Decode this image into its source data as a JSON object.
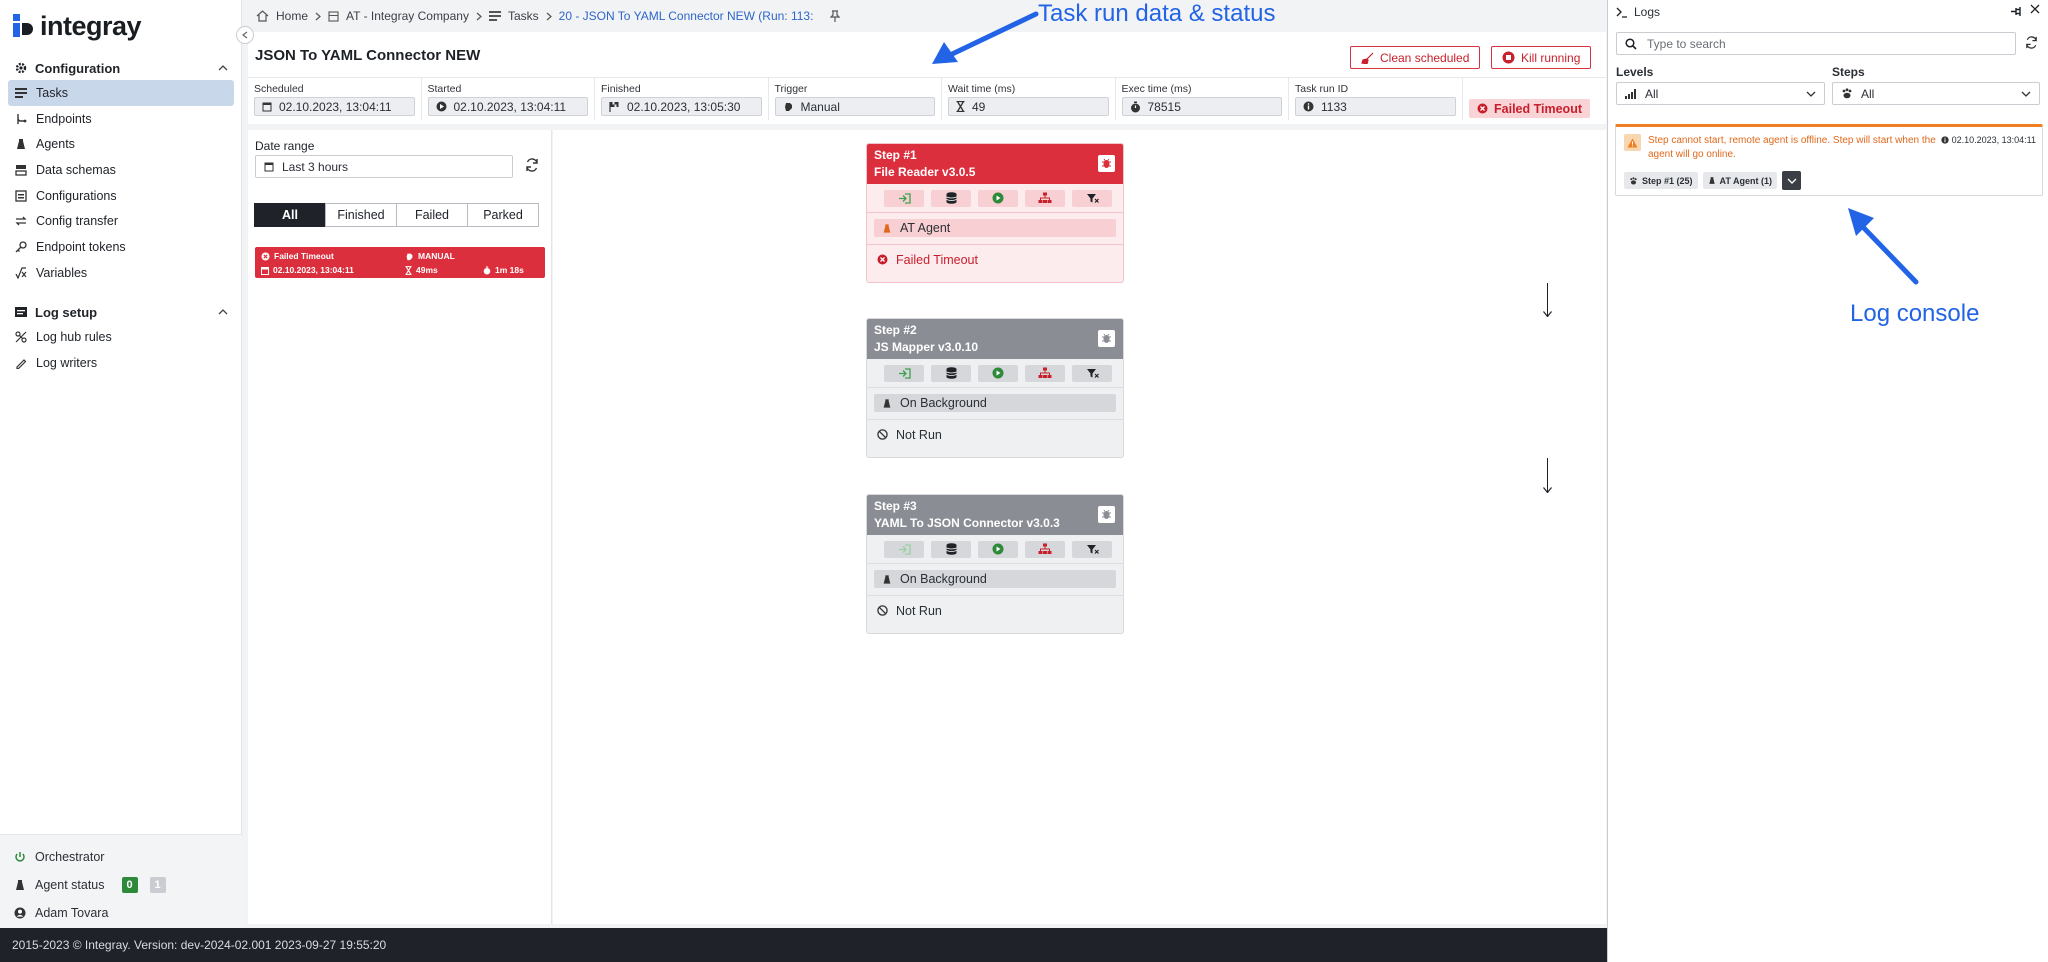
{
  "app": {
    "name": "integray"
  },
  "sidebar": {
    "sections": [
      {
        "title": "Configuration",
        "items": [
          {
            "label": "Tasks",
            "icon": "tasks-icon",
            "active": true
          },
          {
            "label": "Endpoints",
            "icon": "endpoints-icon"
          },
          {
            "label": "Agents",
            "icon": "agents-icon"
          },
          {
            "label": "Data schemas",
            "icon": "data-schemas-icon"
          },
          {
            "label": "Configurations",
            "icon": "configurations-icon"
          },
          {
            "label": "Config transfer",
            "icon": "config-transfer-icon"
          },
          {
            "label": "Endpoint tokens",
            "icon": "endpoint-tokens-icon"
          },
          {
            "label": "Variables",
            "icon": "variables-icon"
          }
        ]
      },
      {
        "title": "Log setup",
        "items": [
          {
            "label": "Log hub rules",
            "icon": "log-hub-rules-icon"
          },
          {
            "label": "Log writers",
            "icon": "log-writers-icon"
          }
        ]
      }
    ],
    "bottom": {
      "orchestrator": "Orchestrator",
      "agent_status": "Agent status",
      "agents_online": "0",
      "agents_offline": "1",
      "user": "Adam Tovara"
    }
  },
  "footer": {
    "text": "2015-2023 © Integray. Version: dev-2024-02.001 2023-09-27 19:55:20"
  },
  "breadcrumb": {
    "home": "Home",
    "company": "AT - Integray Company",
    "tasks": "Tasks",
    "current": "20 - JSON To YAML Connector NEW (Run: 113:"
  },
  "task": {
    "title": "JSON To YAML Connector NEW",
    "clean_scheduled": "Clean scheduled",
    "kill_running": "Kill running",
    "status": "Failed Timeout",
    "fields": [
      {
        "label": "Scheduled",
        "value": "02.10.2023, 13:04:11",
        "icon": "calendar-icon"
      },
      {
        "label": "Started",
        "value": "02.10.2023, 13:04:11",
        "icon": "play-icon"
      },
      {
        "label": "Finished",
        "value": "02.10.2023, 13:05:30",
        "icon": "flag-icon"
      },
      {
        "label": "Trigger",
        "value": "Manual",
        "icon": "hand-icon"
      },
      {
        "label": "Wait time (ms)",
        "value": "49",
        "icon": "hourglass-icon"
      },
      {
        "label": "Exec time (ms)",
        "value": "78515",
        "icon": "stopwatch-icon"
      },
      {
        "label": "Task run ID",
        "value": "1133",
        "icon": "info-icon"
      }
    ]
  },
  "runs": {
    "date_range_label": "Date range",
    "date_range_value": "Last 3 hours",
    "filters": [
      "All",
      "Finished",
      "Failed",
      "Parked"
    ],
    "active_filter": "All",
    "items": [
      {
        "status": "Failed Timeout",
        "trigger": "MANUAL",
        "date": "02.10.2023, 13:04:11",
        "wait": "49ms",
        "duration": "1m 18s"
      }
    ]
  },
  "steps": [
    {
      "title": "Step #1",
      "name": "File Reader v3.0.5",
      "agent": "AT Agent",
      "state": "Failed Timeout",
      "variant": "failed"
    },
    {
      "title": "Step #2",
      "name": "JS Mapper v3.0.10",
      "agent": "On Background",
      "state": "Not Run",
      "variant": "grey"
    },
    {
      "title": "Step #3",
      "name": "YAML To JSON Connector v3.0.3",
      "agent": "On Background",
      "state": "Not Run",
      "variant": "grey"
    }
  ],
  "logs": {
    "title": "Logs",
    "search_placeholder": "Type to search",
    "levels_label": "Levels",
    "levels_value": "All",
    "steps_label": "Steps",
    "steps_value": "All",
    "entries": [
      {
        "message": "Step cannot start, remote agent is offline. Step will start when the agent will go online.",
        "time": "02.10.2023, 13:04:11",
        "tags": [
          "Step #1 (25)",
          "AT Agent (1)"
        ],
        "color": "#e0681c"
      }
    ]
  },
  "annotations": {
    "task_run": "Task run data & status",
    "log_console": "Log console"
  },
  "colors": {
    "accent": "#2264e5",
    "failed": "#dc2f3e",
    "warning": "#ef7f22"
  }
}
